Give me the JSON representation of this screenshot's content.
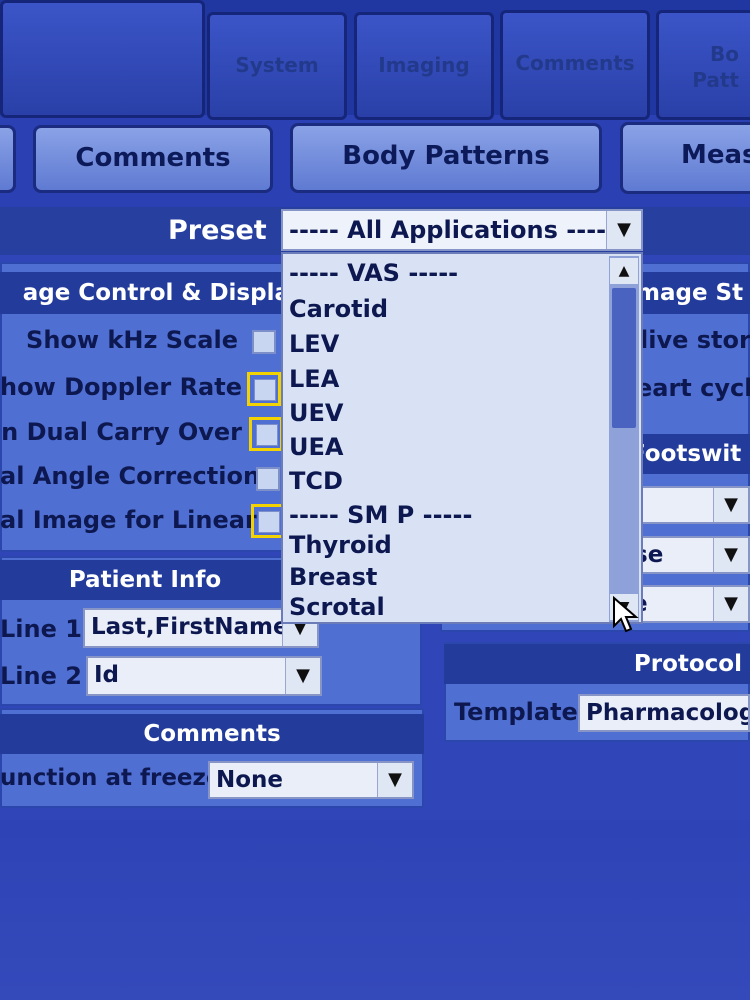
{
  "top_tabs": [
    "System",
    "Imaging",
    "Comments",
    "Body Patterns"
  ],
  "top_tabs_visible": [
    "System",
    "Imaging",
    "Comments",
    "Bo\nPatt"
  ],
  "second_tabs": [
    "Comments",
    "Body Patterns",
    "Meas"
  ],
  "preset": {
    "label": "Preset",
    "value": "----- All Applications -----"
  },
  "preset_list": {
    "items": [
      "----- VAS -----",
      "Carotid",
      "LEV",
      "LEA",
      "UEV",
      "UEA",
      "TCD",
      "----- SM P -----",
      "Thyroid",
      "Breast",
      "Scrotal"
    ]
  },
  "left_panel": {
    "header": "age Control & Displa",
    "options": [
      {
        "label": "Show kHz Scale"
      },
      {
        "label": "how Doppler Rate"
      },
      {
        "label": "n Dual Carry Over"
      },
      {
        "label": "al Angle Correction"
      },
      {
        "label": "al Image for Linear"
      }
    ]
  },
  "patient_info": {
    "header": "Patient Info",
    "line1": {
      "label": "Line 1",
      "value": "Last,FirstName"
    },
    "line2": {
      "label": "Line 2",
      "value": "Id"
    }
  },
  "comments": {
    "header": "Comments",
    "label": "unction at freeze",
    "value": "None"
  },
  "right_panel": {
    "image_store_header": "mage St",
    "line_a": "live stor",
    "line_b": "eart cycle",
    "footswitch_header": "Footswit",
    "combo_a": "se",
    "combo_b": "e"
  },
  "protocol": {
    "header": "Protocol",
    "template_label": "Template",
    "template_value": "Pharmacolog"
  },
  "colors": {
    "header": "#233c9c",
    "panel": "#4f6fd2",
    "highlight": "#f2d200"
  }
}
